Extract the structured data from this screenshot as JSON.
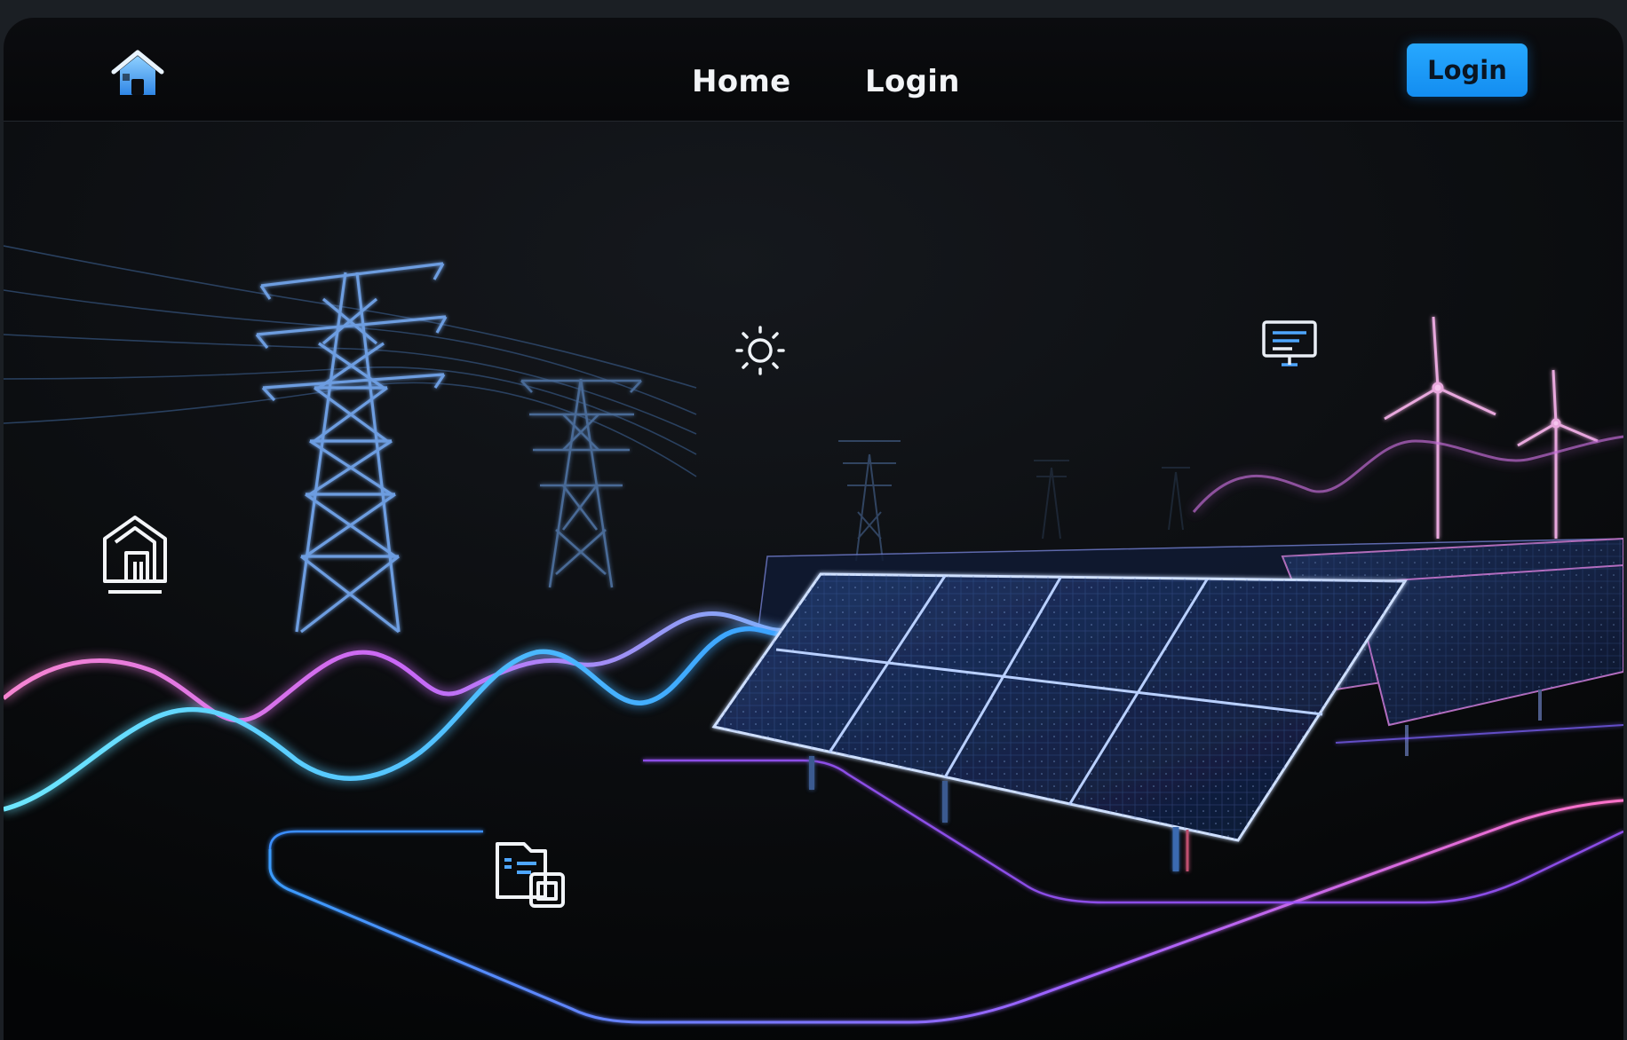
{
  "nav": {
    "home_icon": "home-icon",
    "links": [
      {
        "label": "Home"
      },
      {
        "label": "Login"
      }
    ],
    "login_button": "Login"
  },
  "hero": {
    "icons": [
      "building-icon",
      "sun-icon",
      "monitor-icon",
      "documents-icon"
    ],
    "illustration": [
      "power-transmission-towers",
      "solar-panel-array",
      "wind-turbines",
      "energy-waves"
    ]
  },
  "colors": {
    "accent": "#1e9bff",
    "wave_cyan": "#4fd8ff",
    "wave_pink": "#ff7ad9",
    "background": "#050608"
  }
}
